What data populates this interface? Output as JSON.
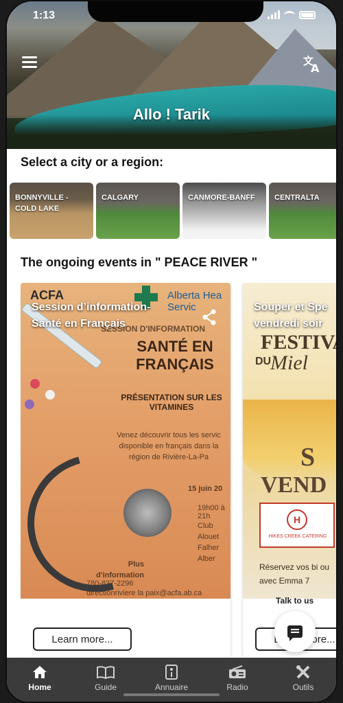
{
  "status_bar": {
    "time": "1:13"
  },
  "hero": {
    "title": "Allo ! Tarik"
  },
  "cities": {
    "heading": "Select a city or a region:",
    "items": [
      {
        "label": "BONNYVILLE - COLD LAKE"
      },
      {
        "label": "CALGARY"
      },
      {
        "label": "CANMORE-BANFF"
      },
      {
        "label": "CENTRALTA"
      }
    ]
  },
  "events": {
    "heading": "The ongoing events in \" PEACE RIVER \"",
    "cards": [
      {
        "title": "Session d’information- Santé en Français",
        "learn_more": "Learn more...",
        "poster": {
          "org_left": "ACFA",
          "org_right": "Alberta Hea Servic",
          "line1": "SESSION D'INFORMATION",
          "headline": "SANTÉ EN FRANÇAIS",
          "sub": "PRÉSENTATION SUR LES VITAMINES",
          "body": "Venez découvrir tous les servic disponible en français dans la région de Rivière-La-Pa",
          "date": "15 juin 20",
          "time": "19h00 à 21h",
          "place": "Club Alouet Falher Alber",
          "more": "Plus d'information",
          "phone": "780-837-2296",
          "email": "directionriviere la paix@acfa.ab.ca"
        }
      },
      {
        "title": "Souper et Spe vendredi soir",
        "learn_more": "Learn more...",
        "poster": {
          "fest": "FESTIVA",
          "du": "DU",
          "miel": "Miel",
          "big": "S",
          "vend": "VEND",
          "catering": "HIKES CREEK CATERING",
          "reserve": "Réservez vos bi ou avec Emma 7"
        }
      }
    ]
  },
  "talk_to_us": "Talk to us",
  "nav": [
    {
      "label": "Home",
      "icon": "home-icon"
    },
    {
      "label": "Guide",
      "icon": "book-icon"
    },
    {
      "label": "Annuaire",
      "icon": "directory-icon"
    },
    {
      "label": "Radio",
      "icon": "radio-icon"
    },
    {
      "label": "Outils",
      "icon": "tools-icon"
    }
  ]
}
